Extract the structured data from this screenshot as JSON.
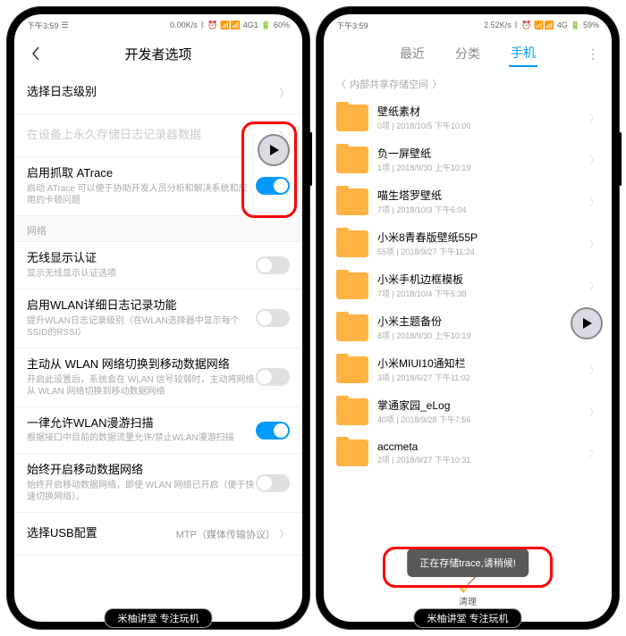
{
  "left": {
    "status": {
      "time": "下午3:59",
      "net": "0.00K/s",
      "sig": "4G1",
      "batt": "60%"
    },
    "header_title": "开发者选项",
    "items": {
      "log_level": {
        "title": "选择日志级别"
      },
      "log_store": {
        "title": "在设备上永久存储日志记录器数据"
      },
      "atrace": {
        "title": "启用抓取 ATrace",
        "desc": "启动 ATrace 可以便于协助开发人员分析和解决系统和应用的卡顿问题"
      },
      "network_section": "网络",
      "wifi_cert": {
        "title": "无线显示认证",
        "desc": "显示无线显示认证选项"
      },
      "wlan_verbose": {
        "title": "启用WLAN详细日志记录功能",
        "desc": "提升WLAN日志记录级别（在WLAN选择器中显示每个SSID的RSSI）"
      },
      "wlan_to_mobile": {
        "title": "主动从 WLAN 网络切换到移动数据网络",
        "desc": "开启此设置后，系统会在 WLAN 信号较弱时，主动将网络从 WLAN 网络切换到移动数据网络"
      },
      "wlan_roam": {
        "title": "一律允许WLAN漫游扫描",
        "desc": "根据接口中目前的数据流量允许/禁止WLAN漫游扫描"
      },
      "mobile_always": {
        "title": "始终开启移动数据网络",
        "desc": "始终开启移动数据网络，即使 WLAN 网络已开启（便于快速切换网络）。"
      },
      "usb": {
        "title": "选择USB配置",
        "value": "MTP（媒体传输协议）"
      }
    }
  },
  "right": {
    "status": {
      "time": "下午3:59",
      "net": "2.52K/s",
      "sig": "4G",
      "batt": "59%"
    },
    "tabs": {
      "recent": "最近",
      "category": "分类",
      "phone": "手机"
    },
    "breadcrumb": "内部共享存储空间",
    "folders": [
      {
        "name": "壁纸素材",
        "count": "0项",
        "date": "2018/10/5 下午10:00"
      },
      {
        "name": "负一屏壁纸",
        "count": "1项",
        "date": "2018/9/30 上午10:19"
      },
      {
        "name": "喵生塔罗壁纸",
        "count": "7项",
        "date": "2018/10/3 下午6:04"
      },
      {
        "name": "小米8青春版壁纸55P",
        "count": "55项",
        "date": "2018/9/27 下午11:24"
      },
      {
        "name": "小米手机边框模板",
        "count": "7项",
        "date": "2018/10/4 下午5:38"
      },
      {
        "name": "小米主题备份",
        "count": "8项",
        "date": "2018/9/30 上午10:19"
      },
      {
        "name": "小米MIUI10通知栏",
        "count": "3项",
        "date": "2018/6/27 下午11:02"
      },
      {
        "name": "掌通家园_eLog",
        "count": "40项",
        "date": "2018/9/28 下午7:56"
      },
      {
        "name": "accmeta",
        "count": "2项",
        "date": "2018/9/27 下午10:31"
      }
    ],
    "toast": "正在存储trace,请稍候!",
    "clean": "清理"
  },
  "watermark": "米柚讲堂 专注玩机"
}
